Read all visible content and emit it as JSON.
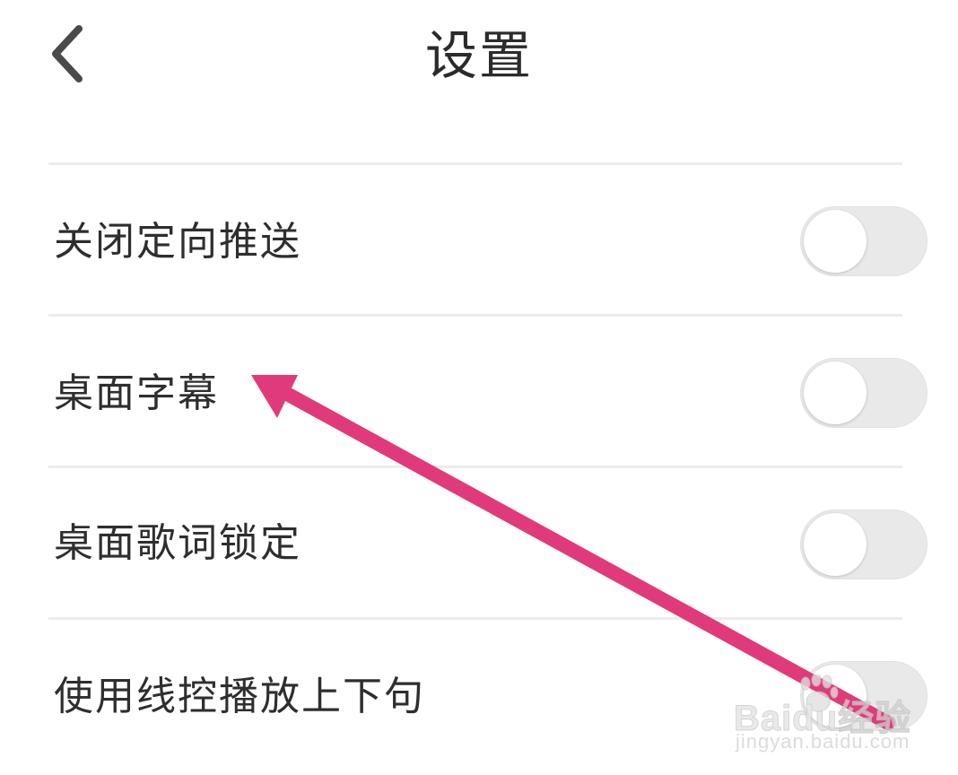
{
  "header": {
    "title": "设置"
  },
  "settings": {
    "items": [
      {
        "label": "关闭定向推送",
        "enabled": false
      },
      {
        "label": "桌面字幕",
        "enabled": false
      },
      {
        "label": "桌面歌词锁定",
        "enabled": false
      },
      {
        "label": "使用线控播放上下句",
        "enabled": false
      }
    ]
  },
  "annotation": {
    "arrow_color": "#e03a7a"
  },
  "watermark": {
    "brand": "Baidu经验",
    "url": "jingyan.baidu.com"
  },
  "colors": {
    "toggle_off_track": "#e9e9e9",
    "toggle_knob": "#ffffff",
    "text_primary": "#2e2e2e",
    "divider": "#ececec"
  }
}
